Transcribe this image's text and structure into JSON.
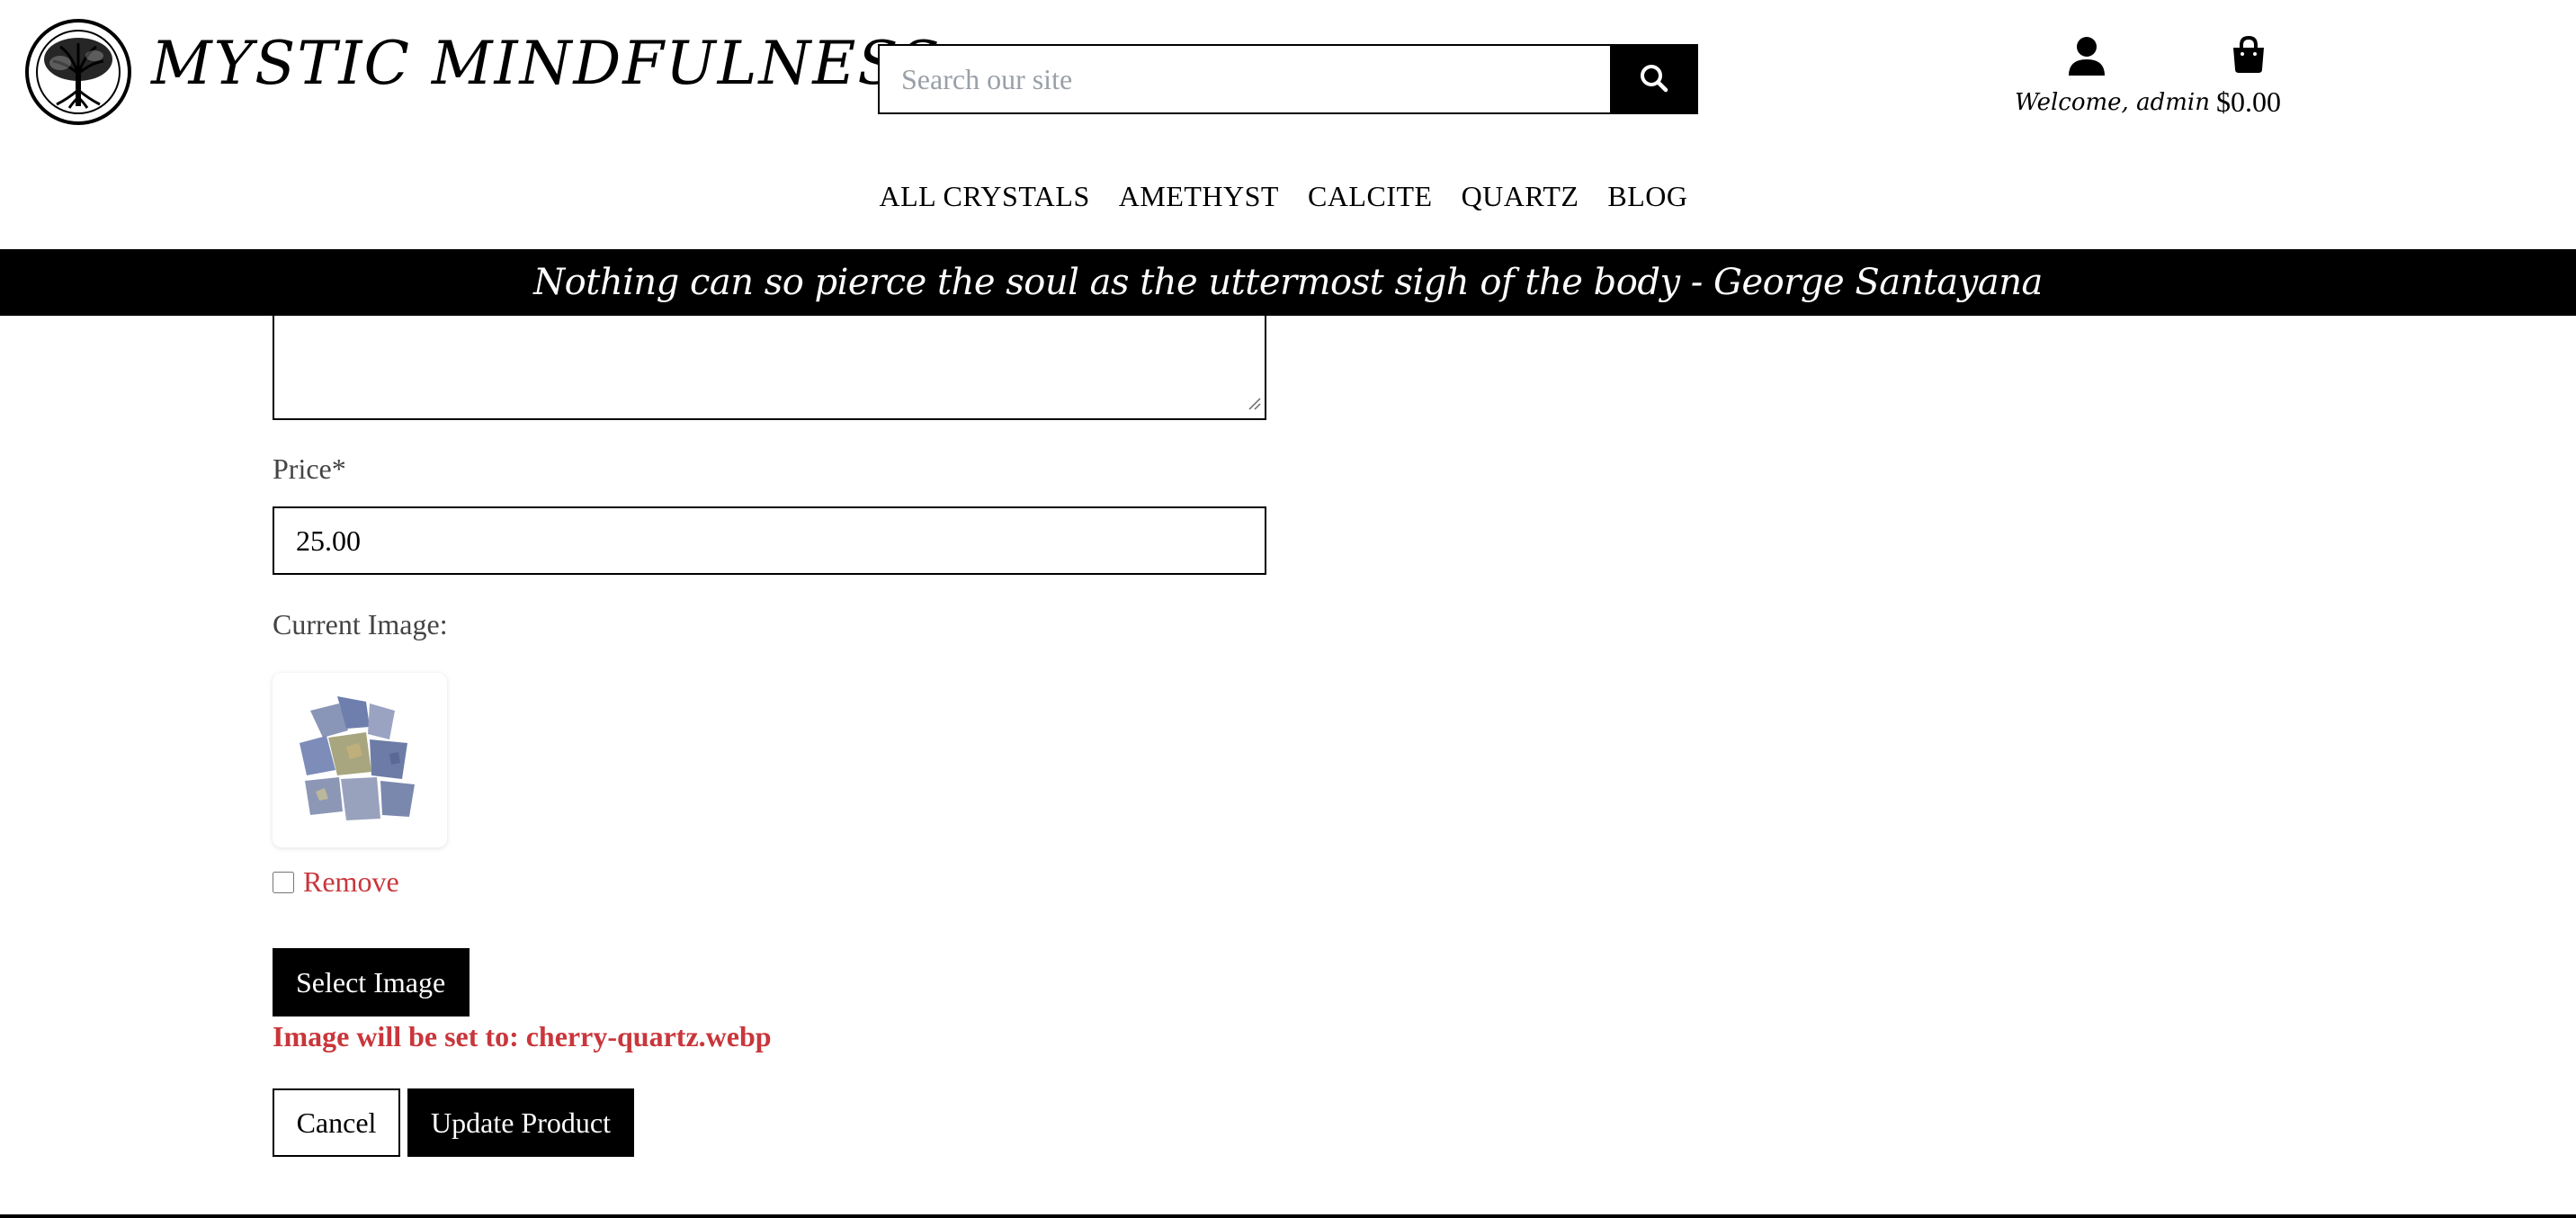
{
  "header": {
    "logo_text": "MYSTIC MINDFULNESS",
    "logo_icon": "tree-of-life-icon",
    "search_placeholder": "Search our site",
    "search_icon": "search-icon",
    "account_label": "Welcome, admin",
    "account_icon": "user-icon",
    "cart_total": "$0.00",
    "cart_icon": "shopping-bag-icon"
  },
  "nav": {
    "items": [
      "ALL CRYSTALS",
      "AMETHYST",
      "CALCITE",
      "QUARTZ",
      "BLOG"
    ]
  },
  "quote": "Nothing can so pierce the soul as the uttermost sigh of the body - George Santayana",
  "form": {
    "price_label": "Price*",
    "price_value": "25.00",
    "current_image_label": "Current Image:",
    "remove_label": "Remove",
    "select_image_label": "Select Image",
    "image_note": "Image will be set to: cherry-quartz.webp",
    "cancel_label": "Cancel",
    "update_label": "Update Product"
  },
  "colors": {
    "accent": "#000000",
    "error_red": "#c9363b"
  }
}
